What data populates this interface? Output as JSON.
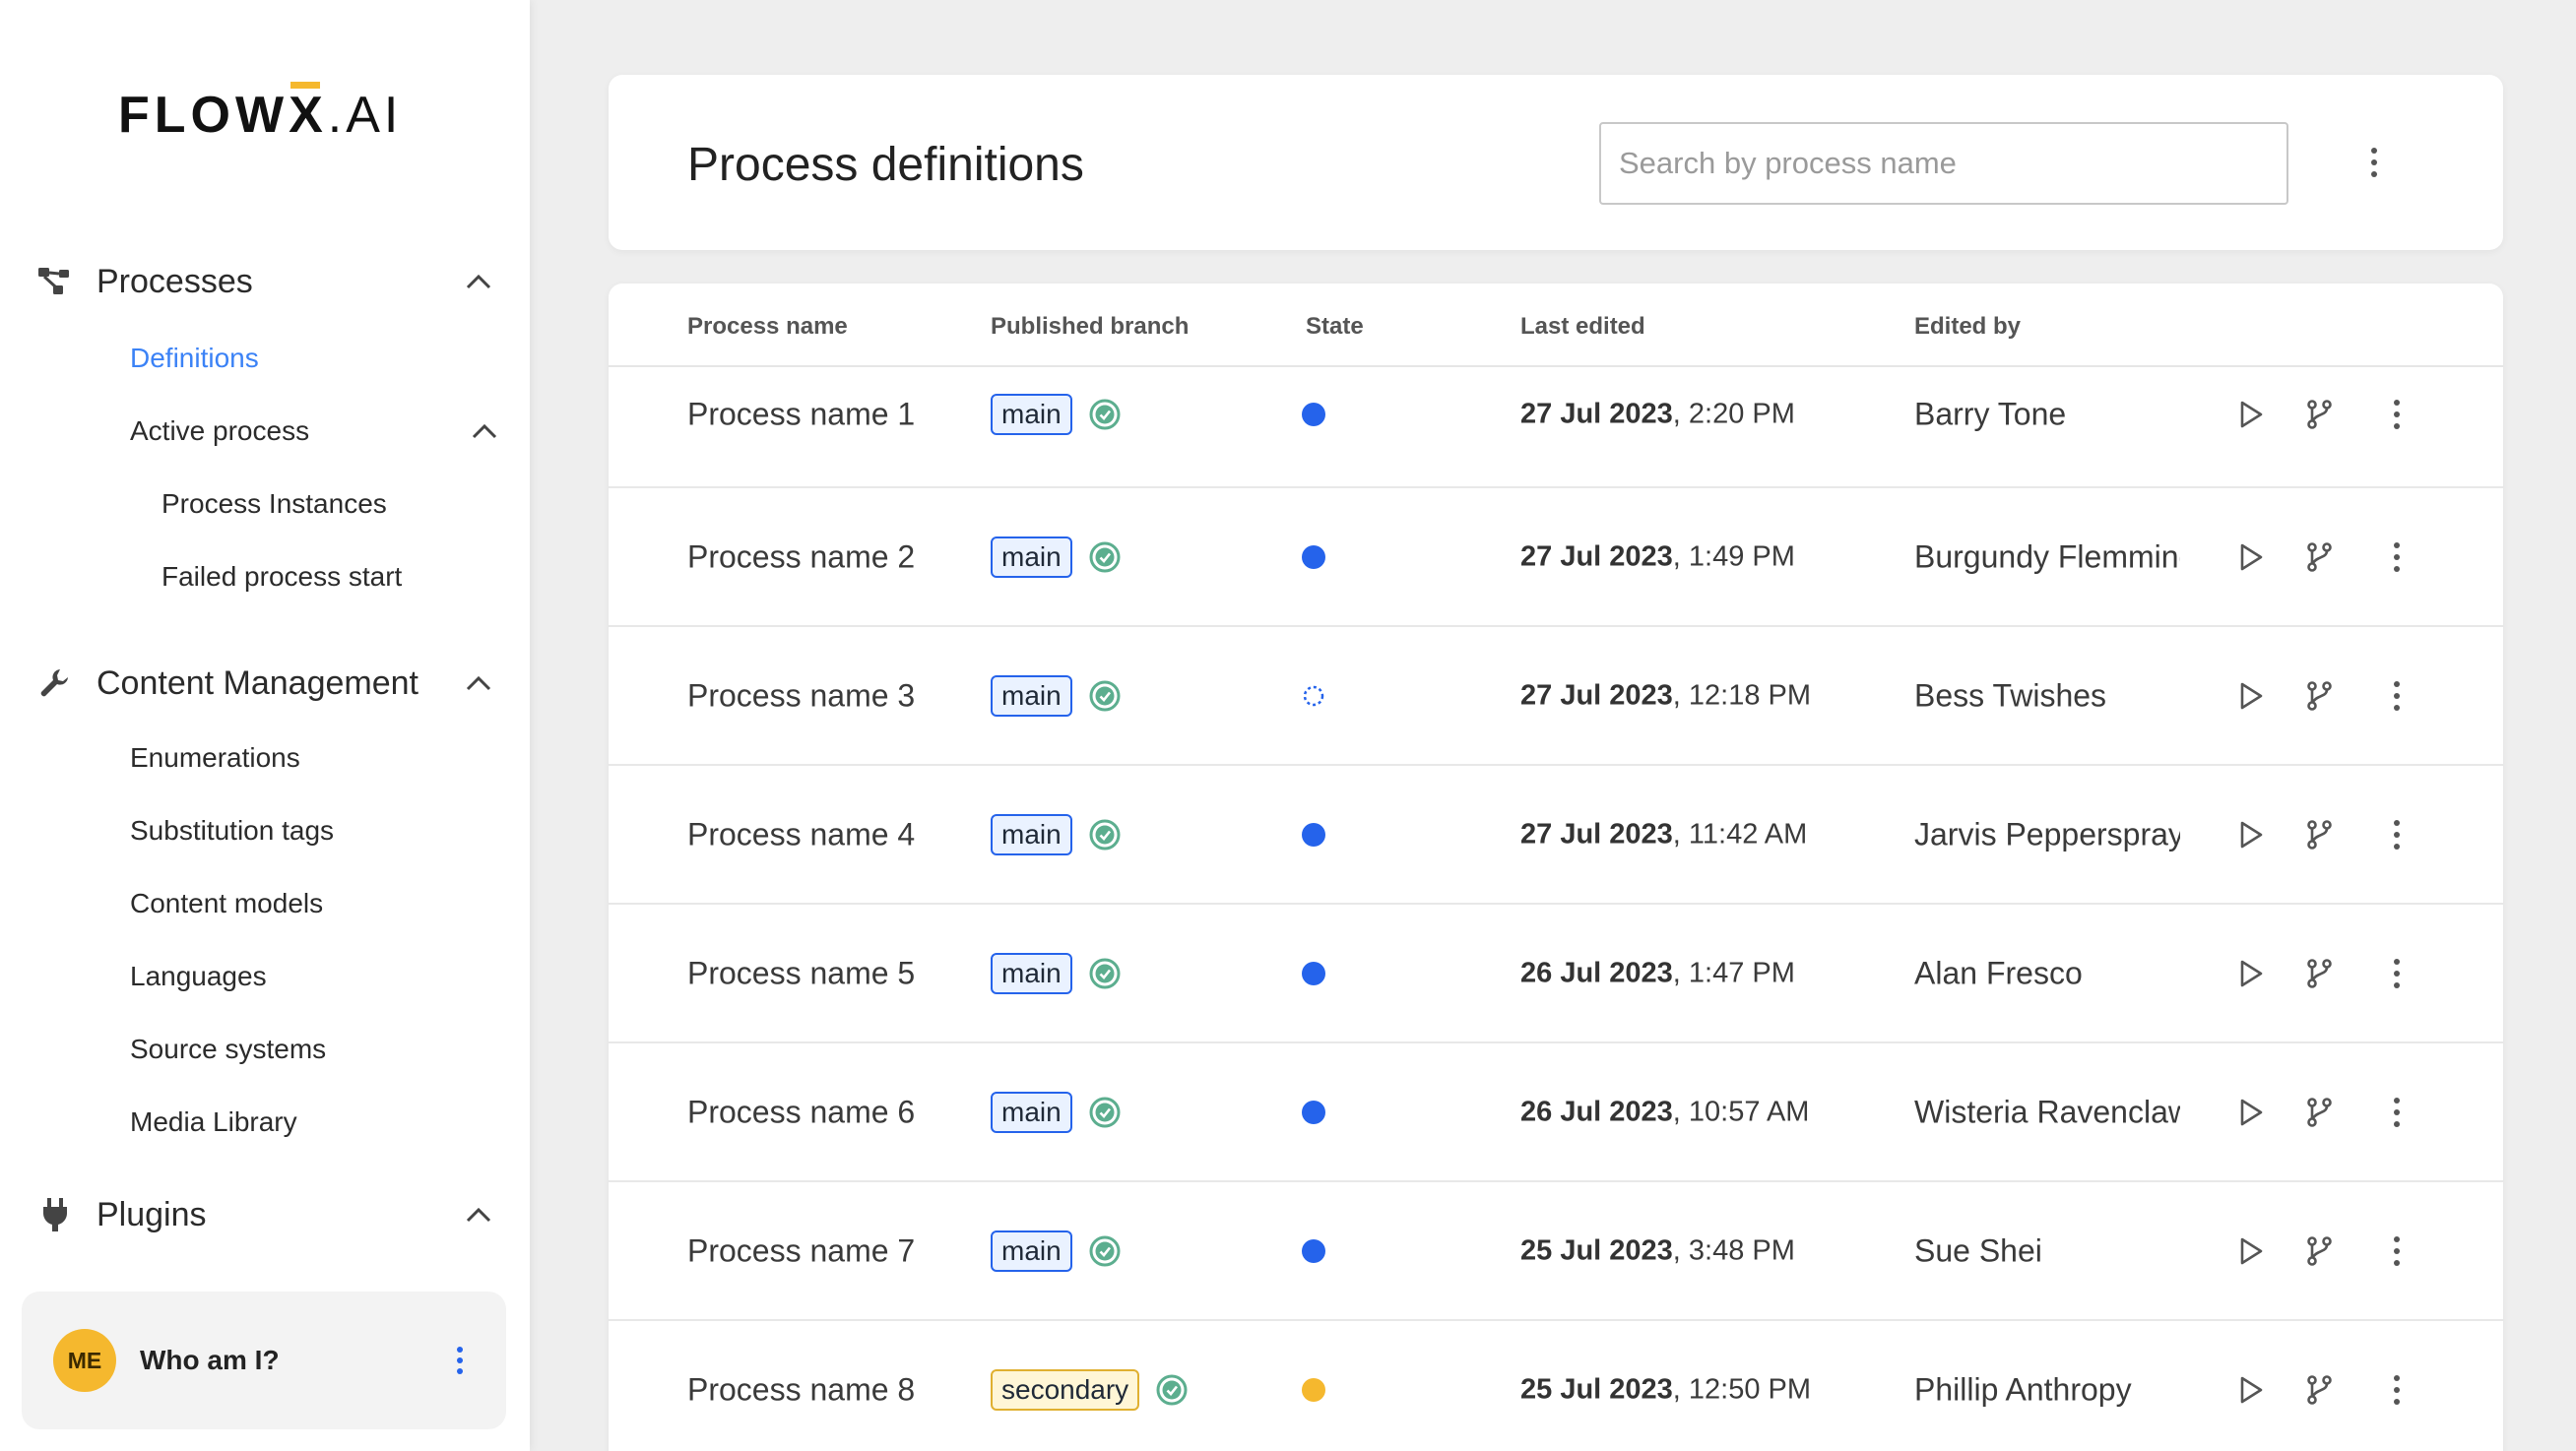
{
  "brand": {
    "logo_main": "FLOW",
    "logo_x": "X",
    "logo_suffix": ".AI",
    "accent": "#f5b82e"
  },
  "sidebar": {
    "groups": [
      {
        "label": "Processes",
        "icon": "process-tree-icon"
      },
      {
        "label": "Content Management",
        "icon": "wrench-icon"
      },
      {
        "label": "Plugins",
        "icon": "plug-icon"
      }
    ],
    "processes": {
      "definitions": "Definitions",
      "active_process": "Active process",
      "process_instances": "Process Instances",
      "failed_process_start": "Failed process start"
    },
    "content": {
      "enumerations": "Enumerations",
      "substitution_tags": "Substitution tags",
      "content_models": "Content models",
      "languages": "Languages",
      "source_systems": "Source systems",
      "media_library": "Media Library"
    },
    "user": {
      "initials": "ME",
      "name": "Who am I?"
    }
  },
  "header": {
    "title": "Process definitions",
    "search_placeholder": "Search by process name"
  },
  "table": {
    "columns": {
      "name": "Process name",
      "branch": "Published branch",
      "state": "State",
      "edited": "Last edited",
      "editor": "Edited by"
    },
    "rows": [
      {
        "name": "Process name 1",
        "branch": "main",
        "state": "active",
        "date": "27 Jul 2023",
        "time": ", 2:20 PM",
        "editor": "Barry Tone"
      },
      {
        "name": "Process name 2",
        "branch": "main",
        "state": "active",
        "date": "27 Jul 2023",
        "time": ", 1:49 PM",
        "editor": "Burgundy Flemming"
      },
      {
        "name": "Process name 3",
        "branch": "main",
        "state": "pending",
        "date": "27 Jul 2023",
        "time": ", 12:18 PM",
        "editor": "Bess Twishes"
      },
      {
        "name": "Process name 4",
        "branch": "main",
        "state": "active",
        "date": "27 Jul 2023",
        "time": ", 11:42 AM",
        "editor": "Jarvis Pepperspray"
      },
      {
        "name": "Process name 5",
        "branch": "main",
        "state": "active",
        "date": "26 Jul 2023",
        "time": ", 1:47 PM",
        "editor": "Alan Fresco"
      },
      {
        "name": "Process name 6",
        "branch": "main",
        "state": "active",
        "date": "26 Jul 2023",
        "time": ", 10:57 AM",
        "editor": "Wisteria Ravenclaw"
      },
      {
        "name": "Process name 7",
        "branch": "main",
        "state": "active",
        "date": "25 Jul 2023",
        "time": ", 3:48 PM",
        "editor": "Sue Shei"
      },
      {
        "name": "Process name 8",
        "branch": "secondary",
        "state": "warning",
        "date": "25 Jul 2023",
        "time": ", 12:50 PM",
        "editor": "Phillip Anthropy"
      }
    ]
  },
  "colors": {
    "active": "#2563eb",
    "warning": "#f5b82e",
    "check": "#5cae8f",
    "link": "#3b82f6"
  }
}
